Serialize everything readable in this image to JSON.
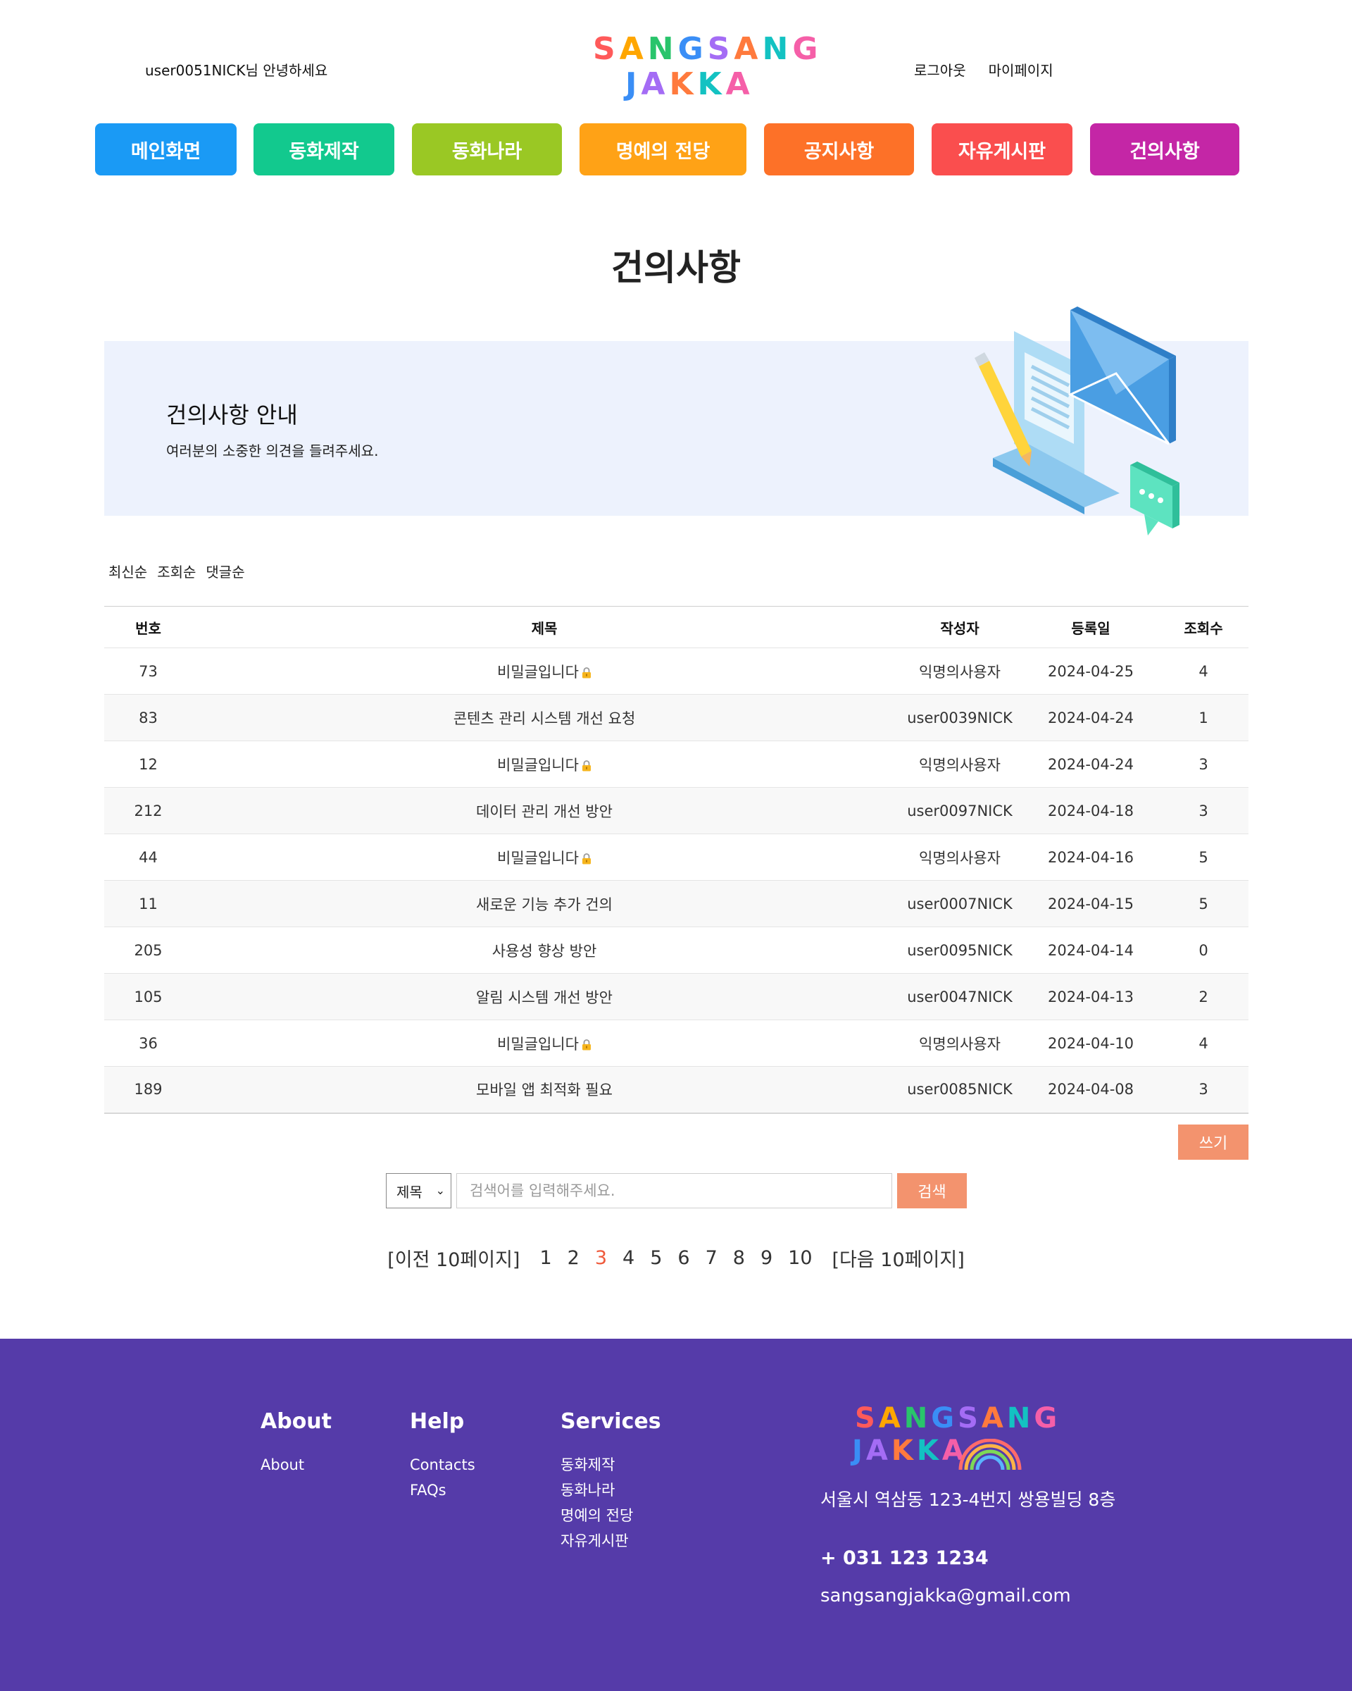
{
  "header": {
    "greeting": "user0051NICK님 안녕하세요",
    "logo_line1": "SANGSANG",
    "logo_line2": "JAKKA",
    "logout": "로그아웃",
    "mypage": "마이페이지"
  },
  "nav": [
    {
      "label": "메인화면",
      "color": "#1a9af5"
    },
    {
      "label": "동화제작",
      "color": "#12c98e"
    },
    {
      "label": "동화나라",
      "color": "#9ac824"
    },
    {
      "label": "명예의 전당",
      "color": "#ffa216"
    },
    {
      "label": "공지사항",
      "color": "#fd7128"
    },
    {
      "label": "자유게시판",
      "color": "#fa4e4e"
    },
    {
      "label": "건의사항",
      "color": "#c426a6"
    }
  ],
  "page_title": "건의사항",
  "banner": {
    "title": "건의사항 안내",
    "description": "여러분의 소중한 의견을 들려주세요."
  },
  "sort": [
    "최신순",
    "조회순",
    "댓글순"
  ],
  "table": {
    "headers": [
      "번호",
      "제목",
      "작성자",
      "등록일",
      "조회수"
    ],
    "rows": [
      {
        "no": "73",
        "title": "비밀글입니다",
        "locked": true,
        "author": "익명의사용자",
        "date": "2024-04-25",
        "views": "4"
      },
      {
        "no": "83",
        "title": "콘텐츠 관리 시스템 개선 요청",
        "locked": false,
        "author": "user0039NICK",
        "date": "2024-04-24",
        "views": "1"
      },
      {
        "no": "12",
        "title": "비밀글입니다",
        "locked": true,
        "author": "익명의사용자",
        "date": "2024-04-24",
        "views": "3"
      },
      {
        "no": "212",
        "title": "데이터 관리 개선 방안",
        "locked": false,
        "author": "user0097NICK",
        "date": "2024-04-18",
        "views": "3"
      },
      {
        "no": "44",
        "title": "비밀글입니다",
        "locked": true,
        "author": "익명의사용자",
        "date": "2024-04-16",
        "views": "5"
      },
      {
        "no": "11",
        "title": "새로운 기능 추가 건의",
        "locked": false,
        "author": "user0007NICK",
        "date": "2024-04-15",
        "views": "5"
      },
      {
        "no": "205",
        "title": "사용성 향상 방안",
        "locked": false,
        "author": "user0095NICK",
        "date": "2024-04-14",
        "views": "0"
      },
      {
        "no": "105",
        "title": "알림 시스템 개선 방안",
        "locked": false,
        "author": "user0047NICK",
        "date": "2024-04-13",
        "views": "2"
      },
      {
        "no": "36",
        "title": "비밀글입니다",
        "locked": true,
        "author": "익명의사용자",
        "date": "2024-04-10",
        "views": "4"
      },
      {
        "no": "189",
        "title": "모바일 앱 최적화 필요",
        "locked": false,
        "author": "user0085NICK",
        "date": "2024-04-08",
        "views": "3"
      }
    ]
  },
  "write_button": "쓰기",
  "search": {
    "select_value": "제목",
    "placeholder": "검색어를 입력해주세요.",
    "button": "검색"
  },
  "pagination": {
    "prev": "[이전 10페이지]",
    "pages": [
      "1",
      "2",
      "3",
      "4",
      "5",
      "6",
      "7",
      "8",
      "9",
      "10"
    ],
    "current": "3",
    "next": "[다음 10페이지]"
  },
  "footer": {
    "about": {
      "heading": "About",
      "links": [
        "About"
      ]
    },
    "help": {
      "heading": "Help",
      "links": [
        "Contacts",
        "FAQs"
      ]
    },
    "services": {
      "heading": "Services",
      "links": [
        "동화제작",
        "동화나라",
        "명예의 전당",
        "자유게시판"
      ]
    },
    "logo_line1": "SANGSANG",
    "logo_line2": "JAKKA",
    "address": "서울시 역삼동 123-4번지 쌍용빌딩 8층",
    "phone": "+ 031 123 1234",
    "email": "sangsangjakka@gmail.com"
  },
  "colors": {
    "accent": "#f3936e",
    "footer_bg": "#553ba9",
    "banner_bg": "#edf2fd",
    "current_page": "#ef5a3c"
  }
}
